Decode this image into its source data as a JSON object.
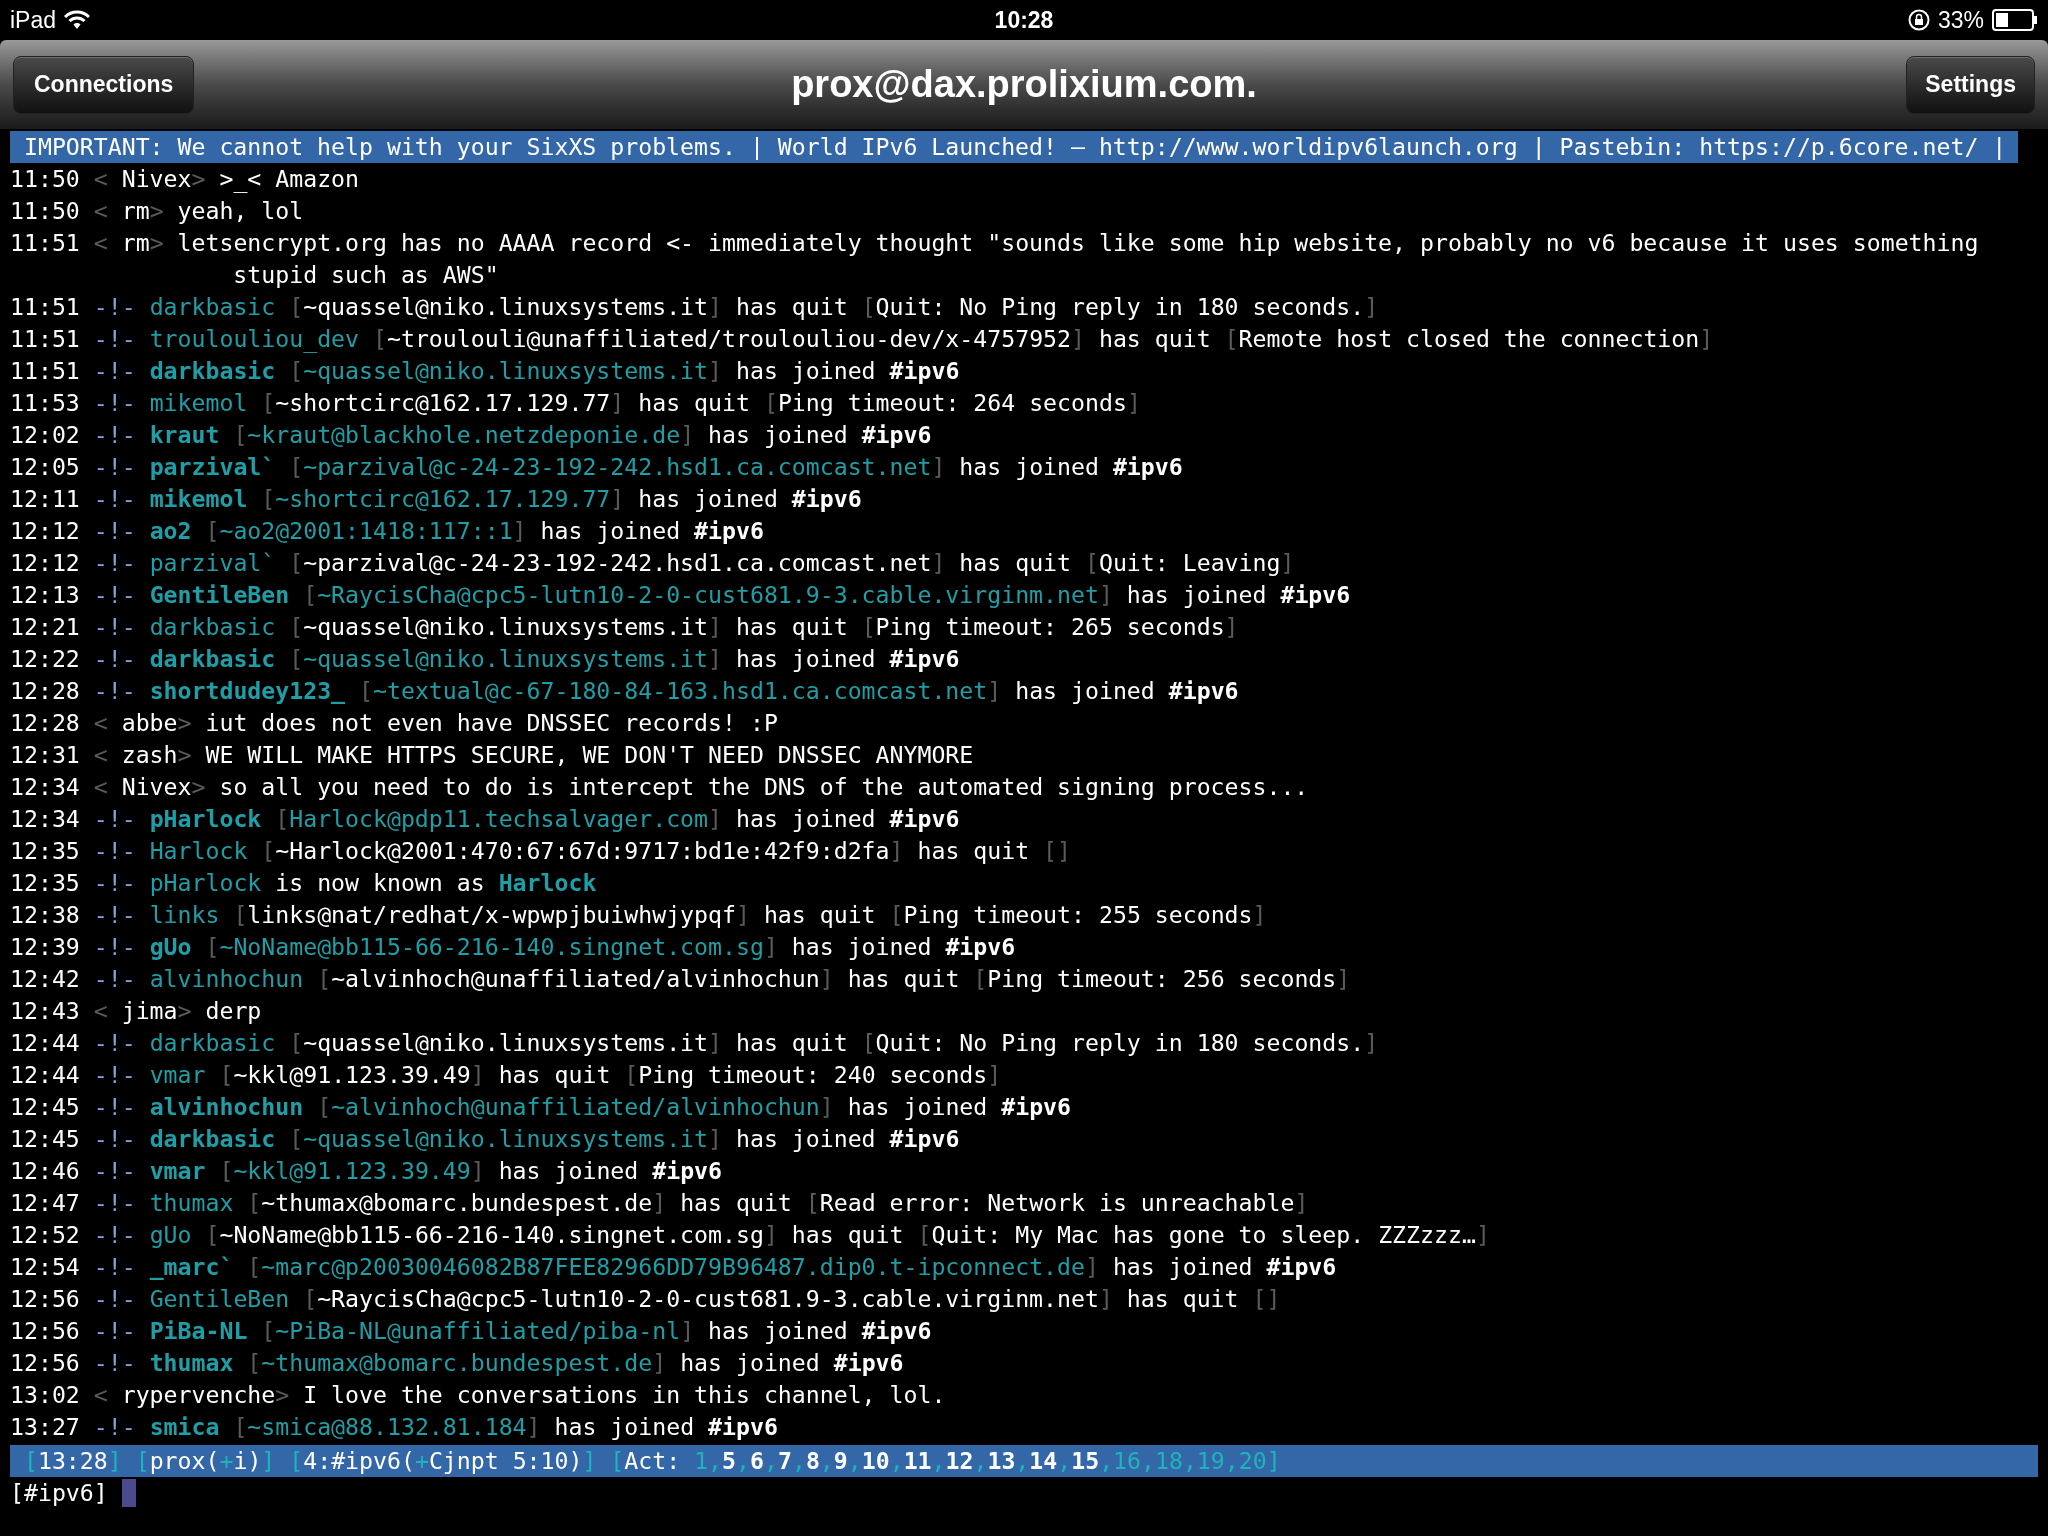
{
  "status_bar": {
    "device": "iPad",
    "time": "10:28",
    "battery": "33%"
  },
  "nav": {
    "left_button": "Connections",
    "title": "prox@dax.prolixium.com.",
    "right_button": "Settings"
  },
  "topic": "IMPORTANT: We cannot help with your SixXS problems. | World IPv6 Launched! – http://www.worldipv6launch.org | Pastebin: https://p.6core.net/ |",
  "lines": [
    {
      "time": "11:50",
      "parts": [
        {
          "kind": "dim",
          "text": "< "
        },
        {
          "kind": "plain",
          "text": "Nivex"
        },
        {
          "kind": "dim",
          "text": ">"
        },
        {
          "kind": "plain",
          "text": " >_< Amazon"
        }
      ]
    },
    {
      "time": "11:50",
      "parts": [
        {
          "kind": "dim",
          "text": "< "
        },
        {
          "kind": "plain",
          "text": "rm"
        },
        {
          "kind": "dim",
          "text": ">"
        },
        {
          "kind": "plain",
          "text": " yeah, lol"
        }
      ]
    },
    {
      "time": "11:51",
      "parts": [
        {
          "kind": "dim",
          "text": "< "
        },
        {
          "kind": "plain",
          "text": "rm"
        },
        {
          "kind": "dim",
          "text": ">"
        },
        {
          "kind": "plain",
          "text": " letsencrypt.org has no AAAA record <- immediately thought \"sounds like some hip website, probably no v6 because it uses something stupid such as AWS\""
        }
      ]
    },
    {
      "time": "11:51",
      "parts": [
        {
          "kind": "marker",
          "text": "-!-"
        },
        {
          "kind": "nick",
          "text": " darkbasic"
        },
        {
          "kind": "dim",
          "text": " ["
        },
        {
          "kind": "plain",
          "text": "~quassel@niko.linuxsystems.it"
        },
        {
          "kind": "dim",
          "text": "]"
        },
        {
          "kind": "plain",
          "text": " has quit "
        },
        {
          "kind": "dim",
          "text": "["
        },
        {
          "kind": "plain",
          "text": "Quit: No Ping reply in 180 seconds."
        },
        {
          "kind": "dim",
          "text": "]"
        }
      ]
    },
    {
      "time": "11:51",
      "parts": [
        {
          "kind": "marker",
          "text": "-!-"
        },
        {
          "kind": "nick",
          "text": " troulouliou_dev"
        },
        {
          "kind": "dim",
          "text": " ["
        },
        {
          "kind": "plain",
          "text": "~troulouli@unaffiliated/troulouliou-dev/x-4757952"
        },
        {
          "kind": "dim",
          "text": "]"
        },
        {
          "kind": "plain",
          "text": " has quit "
        },
        {
          "kind": "dim",
          "text": "["
        },
        {
          "kind": "plain",
          "text": "Remote host closed the connection"
        },
        {
          "kind": "dim",
          "text": "]"
        }
      ]
    },
    {
      "time": "11:51",
      "parts": [
        {
          "kind": "marker",
          "text": "-!-"
        },
        {
          "kind": "nickbold",
          "text": " darkbasic"
        },
        {
          "kind": "dim",
          "text": " ["
        },
        {
          "kind": "nick",
          "text": "~quassel@niko.linuxsystems.it"
        },
        {
          "kind": "dim",
          "text": "]"
        },
        {
          "kind": "plain",
          "text": " has joined "
        },
        {
          "kind": "bold",
          "text": "#ipv6"
        }
      ]
    },
    {
      "time": "11:53",
      "parts": [
        {
          "kind": "marker",
          "text": "-!-"
        },
        {
          "kind": "nick",
          "text": " mikemol"
        },
        {
          "kind": "dim",
          "text": " ["
        },
        {
          "kind": "plain",
          "text": "~shortcirc@162.17.129.77"
        },
        {
          "kind": "dim",
          "text": "]"
        },
        {
          "kind": "plain",
          "text": " has quit "
        },
        {
          "kind": "dim",
          "text": "["
        },
        {
          "kind": "plain",
          "text": "Ping timeout: 264 seconds"
        },
        {
          "kind": "dim",
          "text": "]"
        }
      ]
    },
    {
      "time": "12:02",
      "parts": [
        {
          "kind": "marker",
          "text": "-!-"
        },
        {
          "kind": "nickbold",
          "text": " kraut"
        },
        {
          "kind": "dim",
          "text": " ["
        },
        {
          "kind": "nick",
          "text": "~kraut@blackhole.netzdeponie.de"
        },
        {
          "kind": "dim",
          "text": "]"
        },
        {
          "kind": "plain",
          "text": " has joined "
        },
        {
          "kind": "bold",
          "text": "#ipv6"
        }
      ]
    },
    {
      "time": "12:05",
      "parts": [
        {
          "kind": "marker",
          "text": "-!-"
        },
        {
          "kind": "nickbold",
          "text": " parzival`"
        },
        {
          "kind": "dim",
          "text": " ["
        },
        {
          "kind": "nick",
          "text": "~parzival@c-24-23-192-242.hsd1.ca.comcast.net"
        },
        {
          "kind": "dim",
          "text": "]"
        },
        {
          "kind": "plain",
          "text": " has joined "
        },
        {
          "kind": "bold",
          "text": "#ipv6"
        }
      ]
    },
    {
      "time": "12:11",
      "parts": [
        {
          "kind": "marker",
          "text": "-!-"
        },
        {
          "kind": "nickbold",
          "text": " mikemol"
        },
        {
          "kind": "dim",
          "text": " ["
        },
        {
          "kind": "nick",
          "text": "~shortcirc@162.17.129.77"
        },
        {
          "kind": "dim",
          "text": "]"
        },
        {
          "kind": "plain",
          "text": " has joined "
        },
        {
          "kind": "bold",
          "text": "#ipv6"
        }
      ]
    },
    {
      "time": "12:12",
      "parts": [
        {
          "kind": "marker",
          "text": "-!-"
        },
        {
          "kind": "nickbold",
          "text": " ao2"
        },
        {
          "kind": "dim",
          "text": " ["
        },
        {
          "kind": "nick",
          "text": "~ao2@2001:1418:117::1"
        },
        {
          "kind": "dim",
          "text": "]"
        },
        {
          "kind": "plain",
          "text": " has joined "
        },
        {
          "kind": "bold",
          "text": "#ipv6"
        }
      ]
    },
    {
      "time": "12:12",
      "parts": [
        {
          "kind": "marker",
          "text": "-!-"
        },
        {
          "kind": "nick",
          "text": " parzival`"
        },
        {
          "kind": "dim",
          "text": " ["
        },
        {
          "kind": "plain",
          "text": "~parzival@c-24-23-192-242.hsd1.ca.comcast.net"
        },
        {
          "kind": "dim",
          "text": "]"
        },
        {
          "kind": "plain",
          "text": " has quit "
        },
        {
          "kind": "dim",
          "text": "["
        },
        {
          "kind": "plain",
          "text": "Quit: Leaving"
        },
        {
          "kind": "dim",
          "text": "]"
        }
      ]
    },
    {
      "time": "12:13",
      "parts": [
        {
          "kind": "marker",
          "text": "-!-"
        },
        {
          "kind": "nickbold",
          "text": " GentileBen"
        },
        {
          "kind": "dim",
          "text": " ["
        },
        {
          "kind": "nick",
          "text": "~RaycisCha@cpc5-lutn10-2-0-cust681.9-3.cable.virginm.net"
        },
        {
          "kind": "dim",
          "text": "]"
        },
        {
          "kind": "plain",
          "text": " has joined "
        },
        {
          "kind": "bold",
          "text": "#ipv6"
        }
      ]
    },
    {
      "time": "12:21",
      "parts": [
        {
          "kind": "marker",
          "text": "-!-"
        },
        {
          "kind": "nick",
          "text": " darkbasic"
        },
        {
          "kind": "dim",
          "text": " ["
        },
        {
          "kind": "plain",
          "text": "~quassel@niko.linuxsystems.it"
        },
        {
          "kind": "dim",
          "text": "]"
        },
        {
          "kind": "plain",
          "text": " has quit "
        },
        {
          "kind": "dim",
          "text": "["
        },
        {
          "kind": "plain",
          "text": "Ping timeout: 265 seconds"
        },
        {
          "kind": "dim",
          "text": "]"
        }
      ]
    },
    {
      "time": "12:22",
      "parts": [
        {
          "kind": "marker",
          "text": "-!-"
        },
        {
          "kind": "nickbold",
          "text": " darkbasic"
        },
        {
          "kind": "dim",
          "text": " ["
        },
        {
          "kind": "nick",
          "text": "~quassel@niko.linuxsystems.it"
        },
        {
          "kind": "dim",
          "text": "]"
        },
        {
          "kind": "plain",
          "text": " has joined "
        },
        {
          "kind": "bold",
          "text": "#ipv6"
        }
      ]
    },
    {
      "time": "12:28",
      "parts": [
        {
          "kind": "marker",
          "text": "-!-"
        },
        {
          "kind": "nickbold",
          "text": " shortdudey123_"
        },
        {
          "kind": "dim",
          "text": " ["
        },
        {
          "kind": "nick",
          "text": "~textual@c-67-180-84-163.hsd1.ca.comcast.net"
        },
        {
          "kind": "dim",
          "text": "]"
        },
        {
          "kind": "plain",
          "text": " has joined "
        },
        {
          "kind": "bold",
          "text": "#ipv6"
        }
      ]
    },
    {
      "time": "12:28",
      "parts": [
        {
          "kind": "dim",
          "text": "< "
        },
        {
          "kind": "plain",
          "text": "abbe"
        },
        {
          "kind": "dim",
          "text": ">"
        },
        {
          "kind": "plain",
          "text": " iut does not even have DNSSEC records! :P"
        }
      ]
    },
    {
      "time": "12:31",
      "parts": [
        {
          "kind": "dim",
          "text": "< "
        },
        {
          "kind": "plain",
          "text": "zash"
        },
        {
          "kind": "dim",
          "text": ">"
        },
        {
          "kind": "plain",
          "text": " WE WILL MAKE HTTPS SECURE, WE DON'T NEED DNSSEC ANYMORE"
        }
      ]
    },
    {
      "time": "12:34",
      "parts": [
        {
          "kind": "dim",
          "text": "< "
        },
        {
          "kind": "plain",
          "text": "Nivex"
        },
        {
          "kind": "dim",
          "text": ">"
        },
        {
          "kind": "plain",
          "text": " so all you need to do is intercept the DNS of the automated signing process..."
        }
      ]
    },
    {
      "time": "12:34",
      "parts": [
        {
          "kind": "marker",
          "text": "-!-"
        },
        {
          "kind": "nickbold",
          "text": " pHarlock"
        },
        {
          "kind": "dim",
          "text": " ["
        },
        {
          "kind": "nick",
          "text": "Harlock@pdp11.techsalvager.com"
        },
        {
          "kind": "dim",
          "text": "]"
        },
        {
          "kind": "plain",
          "text": " has joined "
        },
        {
          "kind": "bold",
          "text": "#ipv6"
        }
      ]
    },
    {
      "time": "12:35",
      "parts": [
        {
          "kind": "marker",
          "text": "-!-"
        },
        {
          "kind": "nick",
          "text": " Harlock"
        },
        {
          "kind": "dim",
          "text": " ["
        },
        {
          "kind": "plain",
          "text": "~Harlock@2001:470:67:67d:9717:bd1e:42f9:d2fa"
        },
        {
          "kind": "dim",
          "text": "]"
        },
        {
          "kind": "plain",
          "text": " has quit "
        },
        {
          "kind": "dim",
          "text": "[]"
        }
      ]
    },
    {
      "time": "12:35",
      "parts": [
        {
          "kind": "marker",
          "text": "-!-"
        },
        {
          "kind": "nick",
          "text": " pHarlock"
        },
        {
          "kind": "plain",
          "text": " is now known as "
        },
        {
          "kind": "nickbold",
          "text": "Harlock"
        }
      ]
    },
    {
      "time": "12:38",
      "parts": [
        {
          "kind": "marker",
          "text": "-!-"
        },
        {
          "kind": "nick",
          "text": " links"
        },
        {
          "kind": "dim",
          "text": " ["
        },
        {
          "kind": "plain",
          "text": "links@nat/redhat/x-wpwpjbuiwhwjypqf"
        },
        {
          "kind": "dim",
          "text": "]"
        },
        {
          "kind": "plain",
          "text": " has quit "
        },
        {
          "kind": "dim",
          "text": "["
        },
        {
          "kind": "plain",
          "text": "Ping timeout: 255 seconds"
        },
        {
          "kind": "dim",
          "text": "]"
        }
      ]
    },
    {
      "time": "12:39",
      "parts": [
        {
          "kind": "marker",
          "text": "-!-"
        },
        {
          "kind": "nickbold",
          "text": " gUo"
        },
        {
          "kind": "dim",
          "text": " ["
        },
        {
          "kind": "nick",
          "text": "~NoName@bb115-66-216-140.singnet.com.sg"
        },
        {
          "kind": "dim",
          "text": "]"
        },
        {
          "kind": "plain",
          "text": " has joined "
        },
        {
          "kind": "bold",
          "text": "#ipv6"
        }
      ]
    },
    {
      "time": "12:42",
      "parts": [
        {
          "kind": "marker",
          "text": "-!-"
        },
        {
          "kind": "nick",
          "text": " alvinhochun"
        },
        {
          "kind": "dim",
          "text": " ["
        },
        {
          "kind": "plain",
          "text": "~alvinhoch@unaffiliated/alvinhochun"
        },
        {
          "kind": "dim",
          "text": "]"
        },
        {
          "kind": "plain",
          "text": " has quit "
        },
        {
          "kind": "dim",
          "text": "["
        },
        {
          "kind": "plain",
          "text": "Ping timeout: 256 seconds"
        },
        {
          "kind": "dim",
          "text": "]"
        }
      ]
    },
    {
      "time": "12:43",
      "parts": [
        {
          "kind": "dim",
          "text": "< "
        },
        {
          "kind": "plain",
          "text": "jima"
        },
        {
          "kind": "dim",
          "text": ">"
        },
        {
          "kind": "plain",
          "text": " derp"
        }
      ]
    },
    {
      "time": "12:44",
      "parts": [
        {
          "kind": "marker",
          "text": "-!-"
        },
        {
          "kind": "nick",
          "text": " darkbasic"
        },
        {
          "kind": "dim",
          "text": " ["
        },
        {
          "kind": "plain",
          "text": "~quassel@niko.linuxsystems.it"
        },
        {
          "kind": "dim",
          "text": "]"
        },
        {
          "kind": "plain",
          "text": " has quit "
        },
        {
          "kind": "dim",
          "text": "["
        },
        {
          "kind": "plain",
          "text": "Quit: No Ping reply in 180 seconds."
        },
        {
          "kind": "dim",
          "text": "]"
        }
      ]
    },
    {
      "time": "12:44",
      "parts": [
        {
          "kind": "marker",
          "text": "-!-"
        },
        {
          "kind": "nick",
          "text": " vmar"
        },
        {
          "kind": "dim",
          "text": " ["
        },
        {
          "kind": "plain",
          "text": "~kkl@91.123.39.49"
        },
        {
          "kind": "dim",
          "text": "]"
        },
        {
          "kind": "plain",
          "text": " has quit "
        },
        {
          "kind": "dim",
          "text": "["
        },
        {
          "kind": "plain",
          "text": "Ping timeout: 240 seconds"
        },
        {
          "kind": "dim",
          "text": "]"
        }
      ]
    },
    {
      "time": "12:45",
      "parts": [
        {
          "kind": "marker",
          "text": "-!-"
        },
        {
          "kind": "nickbold",
          "text": " alvinhochun"
        },
        {
          "kind": "dim",
          "text": " ["
        },
        {
          "kind": "nick",
          "text": "~alvinhoch@unaffiliated/alvinhochun"
        },
        {
          "kind": "dim",
          "text": "]"
        },
        {
          "kind": "plain",
          "text": " has joined "
        },
        {
          "kind": "bold",
          "text": "#ipv6"
        }
      ]
    },
    {
      "time": "12:45",
      "parts": [
        {
          "kind": "marker",
          "text": "-!-"
        },
        {
          "kind": "nickbold",
          "text": " darkbasic"
        },
        {
          "kind": "dim",
          "text": " ["
        },
        {
          "kind": "nick",
          "text": "~quassel@niko.linuxsystems.it"
        },
        {
          "kind": "dim",
          "text": "]"
        },
        {
          "kind": "plain",
          "text": " has joined "
        },
        {
          "kind": "bold",
          "text": "#ipv6"
        }
      ]
    },
    {
      "time": "12:46",
      "parts": [
        {
          "kind": "marker",
          "text": "-!-"
        },
        {
          "kind": "nickbold",
          "text": " vmar"
        },
        {
          "kind": "dim",
          "text": " ["
        },
        {
          "kind": "nick",
          "text": "~kkl@91.123.39.49"
        },
        {
          "kind": "dim",
          "text": "]"
        },
        {
          "kind": "plain",
          "text": " has joined "
        },
        {
          "kind": "bold",
          "text": "#ipv6"
        }
      ]
    },
    {
      "time": "12:47",
      "parts": [
        {
          "kind": "marker",
          "text": "-!-"
        },
        {
          "kind": "nick",
          "text": " thumax"
        },
        {
          "kind": "dim",
          "text": " ["
        },
        {
          "kind": "plain",
          "text": "~thumax@bomarc.bundespest.de"
        },
        {
          "kind": "dim",
          "text": "]"
        },
        {
          "kind": "plain",
          "text": " has quit "
        },
        {
          "kind": "dim",
          "text": "["
        },
        {
          "kind": "plain",
          "text": "Read error: Network is unreachable"
        },
        {
          "kind": "dim",
          "text": "]"
        }
      ]
    },
    {
      "time": "12:52",
      "parts": [
        {
          "kind": "marker",
          "text": "-!-"
        },
        {
          "kind": "nick",
          "text": " gUo"
        },
        {
          "kind": "dim",
          "text": " ["
        },
        {
          "kind": "plain",
          "text": "~NoName@bb115-66-216-140.singnet.com.sg"
        },
        {
          "kind": "dim",
          "text": "]"
        },
        {
          "kind": "plain",
          "text": " has quit "
        },
        {
          "kind": "dim",
          "text": "["
        },
        {
          "kind": "plain",
          "text": "Quit: My Mac has gone to sleep. ZZZzzz…"
        },
        {
          "kind": "dim",
          "text": "]"
        }
      ]
    },
    {
      "time": "12:54",
      "parts": [
        {
          "kind": "marker",
          "text": "-!-"
        },
        {
          "kind": "nickbold",
          "text": " _marc`"
        },
        {
          "kind": "dim",
          "text": " ["
        },
        {
          "kind": "nick",
          "text": "~marc@p20030046082B87FEE82966DD79B96487.dip0.t-ipconnect.de"
        },
        {
          "kind": "dim",
          "text": "]"
        },
        {
          "kind": "plain",
          "text": " has joined "
        },
        {
          "kind": "bold",
          "text": "#ipv6"
        }
      ]
    },
    {
      "time": "12:56",
      "parts": [
        {
          "kind": "marker",
          "text": "-!-"
        },
        {
          "kind": "nick",
          "text": " GentileBen"
        },
        {
          "kind": "dim",
          "text": " ["
        },
        {
          "kind": "plain",
          "text": "~RaycisCha@cpc5-lutn10-2-0-cust681.9-3.cable.virginm.net"
        },
        {
          "kind": "dim",
          "text": "]"
        },
        {
          "kind": "plain",
          "text": " has quit "
        },
        {
          "kind": "dim",
          "text": "[]"
        }
      ]
    },
    {
      "time": "12:56",
      "parts": [
        {
          "kind": "marker",
          "text": "-!-"
        },
        {
          "kind": "nickbold",
          "text": " PiBa-NL"
        },
        {
          "kind": "dim",
          "text": " ["
        },
        {
          "kind": "nick",
          "text": "~PiBa-NL@unaffiliated/piba-nl"
        },
        {
          "kind": "dim",
          "text": "]"
        },
        {
          "kind": "plain",
          "text": " has joined "
        },
        {
          "kind": "bold",
          "text": "#ipv6"
        }
      ]
    },
    {
      "time": "12:56",
      "parts": [
        {
          "kind": "marker",
          "text": "-!-"
        },
        {
          "kind": "nickbold",
          "text": " thumax"
        },
        {
          "kind": "dim",
          "text": " ["
        },
        {
          "kind": "nick",
          "text": "~thumax@bomarc.bundespest.de"
        },
        {
          "kind": "dim",
          "text": "]"
        },
        {
          "kind": "plain",
          "text": " has joined "
        },
        {
          "kind": "bold",
          "text": "#ipv6"
        }
      ]
    },
    {
      "time": "13:02",
      "parts": [
        {
          "kind": "dim",
          "text": "< "
        },
        {
          "kind": "plain",
          "text": "rypervenche"
        },
        {
          "kind": "dim",
          "text": ">"
        },
        {
          "kind": "plain",
          "text": " I love the conversations in this channel, lol."
        }
      ]
    },
    {
      "time": "13:27",
      "parts": [
        {
          "kind": "marker",
          "text": "-!-"
        },
        {
          "kind": "nickbold",
          "text": " smica"
        },
        {
          "kind": "dim",
          "text": " ["
        },
        {
          "kind": "nick",
          "text": "~smica@88.132.81.184"
        },
        {
          "kind": "dim",
          "text": "]"
        },
        {
          "kind": "plain",
          "text": " has joined "
        },
        {
          "kind": "bold",
          "text": "#ipv6"
        }
      ]
    }
  ],
  "irc_status": [
    {
      "kind": "accent",
      "text": "["
    },
    {
      "kind": "plain",
      "text": "13:28"
    },
    {
      "kind": "accent",
      "text": "] ["
    },
    {
      "kind": "plain",
      "text": "prox("
    },
    {
      "kind": "accent",
      "text": "+"
    },
    {
      "kind": "plain",
      "text": "i)"
    },
    {
      "kind": "accent",
      "text": "] ["
    },
    {
      "kind": "plain",
      "text": "4:#ipv6("
    },
    {
      "kind": "accent",
      "text": "+"
    },
    {
      "kind": "plain",
      "text": "Cjnpt 5:10)"
    },
    {
      "kind": "accent",
      "text": "] ["
    },
    {
      "kind": "plain",
      "text": "Act: "
    },
    {
      "kind": "accent",
      "text": "1,"
    },
    {
      "kind": "bold",
      "text": "5"
    },
    {
      "kind": "accent",
      "text": ","
    },
    {
      "kind": "bold",
      "text": "6"
    },
    {
      "kind": "accent",
      "text": ","
    },
    {
      "kind": "bold",
      "text": "7"
    },
    {
      "kind": "accent",
      "text": ","
    },
    {
      "kind": "bold",
      "text": "8"
    },
    {
      "kind": "accent",
      "text": ","
    },
    {
      "kind": "bold",
      "text": "9"
    },
    {
      "kind": "accent",
      "text": ","
    },
    {
      "kind": "bold",
      "text": "10"
    },
    {
      "kind": "accent",
      "text": ","
    },
    {
      "kind": "bold",
      "text": "11"
    },
    {
      "kind": "accent",
      "text": ","
    },
    {
      "kind": "bold",
      "text": "12"
    },
    {
      "kind": "accent",
      "text": ","
    },
    {
      "kind": "bold",
      "text": "13"
    },
    {
      "kind": "accent",
      "text": ","
    },
    {
      "kind": "bold",
      "text": "14"
    },
    {
      "kind": "accent",
      "text": ","
    },
    {
      "kind": "bold",
      "text": "15"
    },
    {
      "kind": "accent",
      "text": ",16,18,19,20]"
    }
  ],
  "prompt": "[#ipv6]"
}
